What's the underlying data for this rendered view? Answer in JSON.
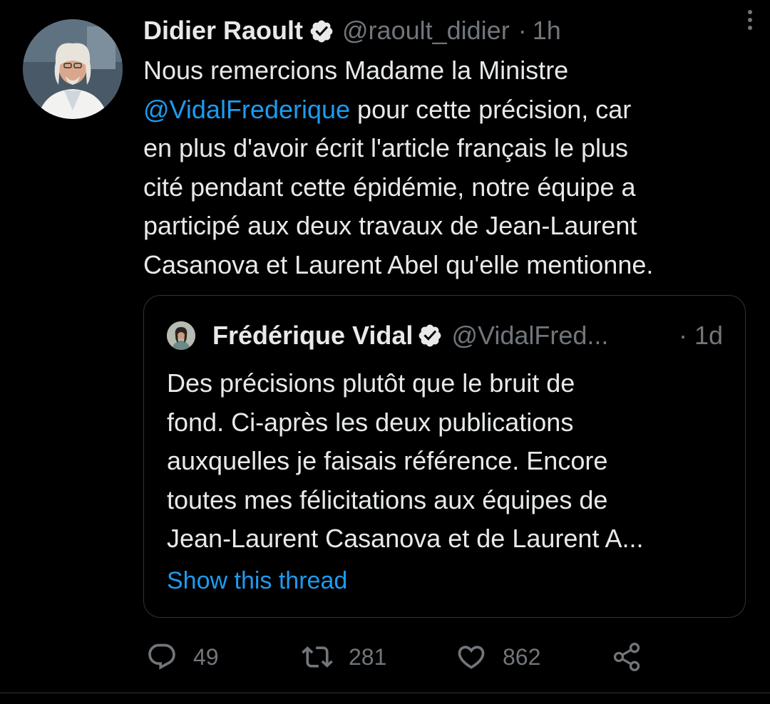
{
  "tweet": {
    "author": {
      "display_name": "Didier Raoult",
      "handle": "@raoult_didier",
      "verified": true,
      "avatar_icon": "avatar-photo"
    },
    "separator": "·",
    "time": "1h",
    "more_icon": "more-vertical-icon",
    "text_before_mention": "Nous remercions Madame la Ministre\n",
    "mention": "@VidalFrederique",
    "text_after_mention": " pour cette précision, car\nen plus d'avoir écrit l'article français le plus\ncité pendant cette épidémie, notre équipe a\nparticipé aux deux travaux de Jean-Laurent\nCasanova et Laurent Abel qu'elle mentionne."
  },
  "quote": {
    "author": {
      "display_name": "Frédérique Vidal",
      "handle": "@VidalFred...",
      "verified": true
    },
    "time": "· 1d",
    "text": "Des précisions plutôt que le bruit de\nfond. Ci-après les deux publications\nauxquelles je faisais référence. Encore\ntoutes mes félicitations aux équipes de\nJean-Laurent Casanova et de Laurent A...",
    "show_thread": "Show this thread"
  },
  "actions": {
    "reply": {
      "icon": "reply-icon",
      "count": "49"
    },
    "retweet": {
      "icon": "retweet-icon",
      "count": "281"
    },
    "like": {
      "icon": "heart-icon",
      "count": "862"
    },
    "share": {
      "icon": "share-icon"
    }
  },
  "colors": {
    "background": "#000000",
    "text": "#e7e9ea",
    "secondary": "#71767b",
    "accent": "#1d9bf0",
    "border": "#2f3336"
  }
}
